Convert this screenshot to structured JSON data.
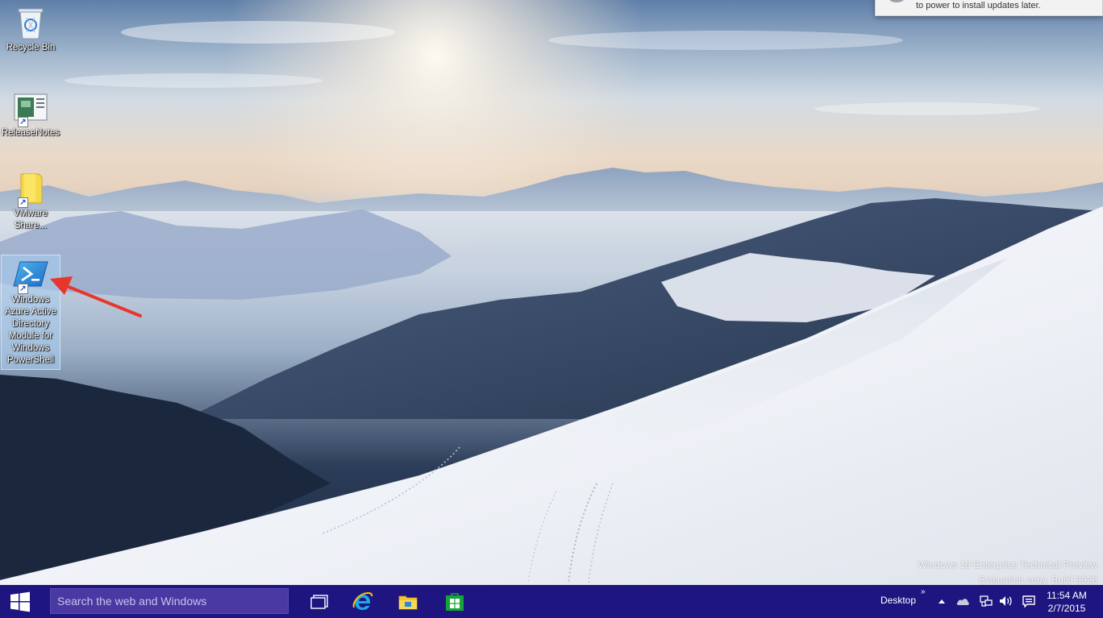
{
  "desktop": {
    "icons": [
      {
        "label": "Recycle Bin"
      },
      {
        "label": "ReleaseNotes"
      },
      {
        "label": "VMware Share..."
      },
      {
        "label": "Windows Azure Active Directory Module for Windows PowerShell"
      }
    ]
  },
  "notification": {
    "text": "to power to install updates later."
  },
  "watermark": {
    "line1": "Windows 10 Enterprise Technical Preview",
    "line2": "Evaluation copy. Build 9926"
  },
  "taskbar": {
    "search_placeholder": "Search the web and Windows",
    "apps": [
      {
        "icon": "task-view-icon"
      },
      {
        "icon": "internet-explorer-icon"
      },
      {
        "icon": "file-explorer-icon"
      },
      {
        "icon": "store-icon"
      }
    ],
    "toolbar_label": "Desktop",
    "toolbar_chevron": "»",
    "tray_icons": [
      "show-hidden-icons-icon",
      "onedrive-icon",
      "network-icon",
      "volume-icon",
      "action-center-icon"
    ],
    "clock": {
      "time": "11:54 AM",
      "date": "2/7/2015"
    }
  },
  "colors": {
    "taskbar": "#1f1580",
    "search_box": "#4a38a3",
    "annotation_arrow": "#e8362b"
  }
}
